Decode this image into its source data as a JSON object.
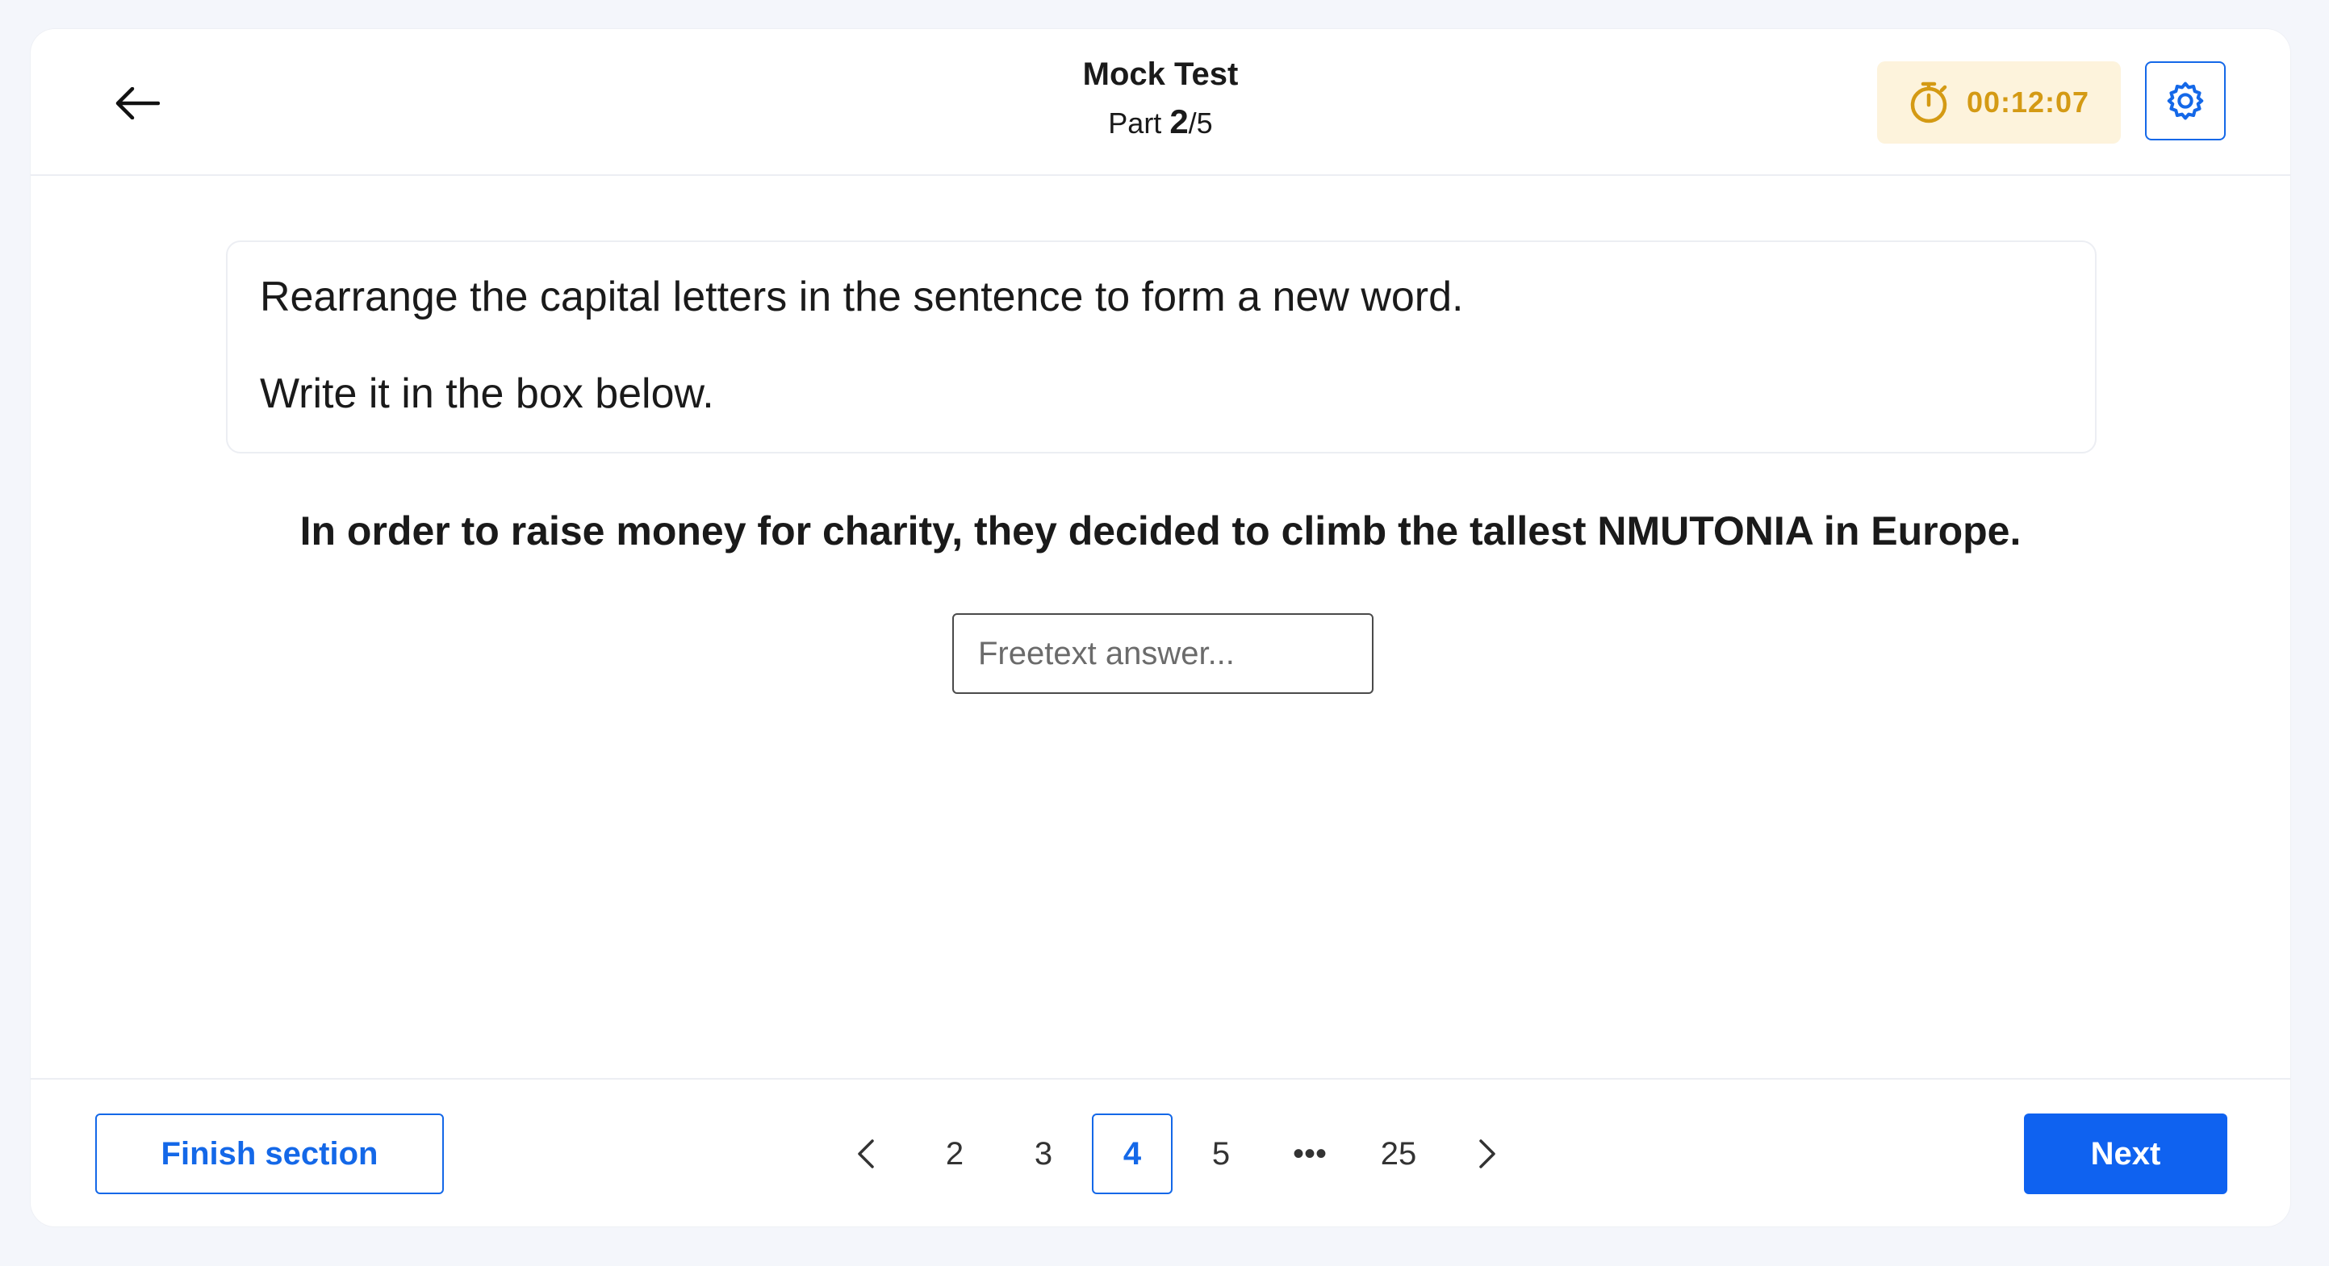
{
  "header": {
    "title": "Mock Test",
    "part_prefix": "Part ",
    "part_current": "2",
    "part_suffix": "/5",
    "timer": "00:12:07",
    "timer_color": "#d49a14",
    "back_icon": "arrow-left-icon",
    "timer_icon": "stopwatch-icon",
    "settings_icon": "gear-icon"
  },
  "instruction": {
    "line1": "Rearrange the capital letters in the sentence to form a new word.",
    "line2": "Write it in the box below."
  },
  "question": {
    "text": "In order to raise money for charity, they decided to climb the tallest NMUTONIA in Europe."
  },
  "answer": {
    "value": "",
    "placeholder": "Freetext answer..."
  },
  "footer": {
    "finish_label": "Finish section",
    "next_label": "Next",
    "accent_color": "#1468e8",
    "pagination": {
      "prev_icon": "chevron-left-icon",
      "next_icon": "chevron-right-icon",
      "pages": [
        "2",
        "3",
        "4",
        "5",
        "•••",
        "25"
      ],
      "current": "4"
    }
  }
}
